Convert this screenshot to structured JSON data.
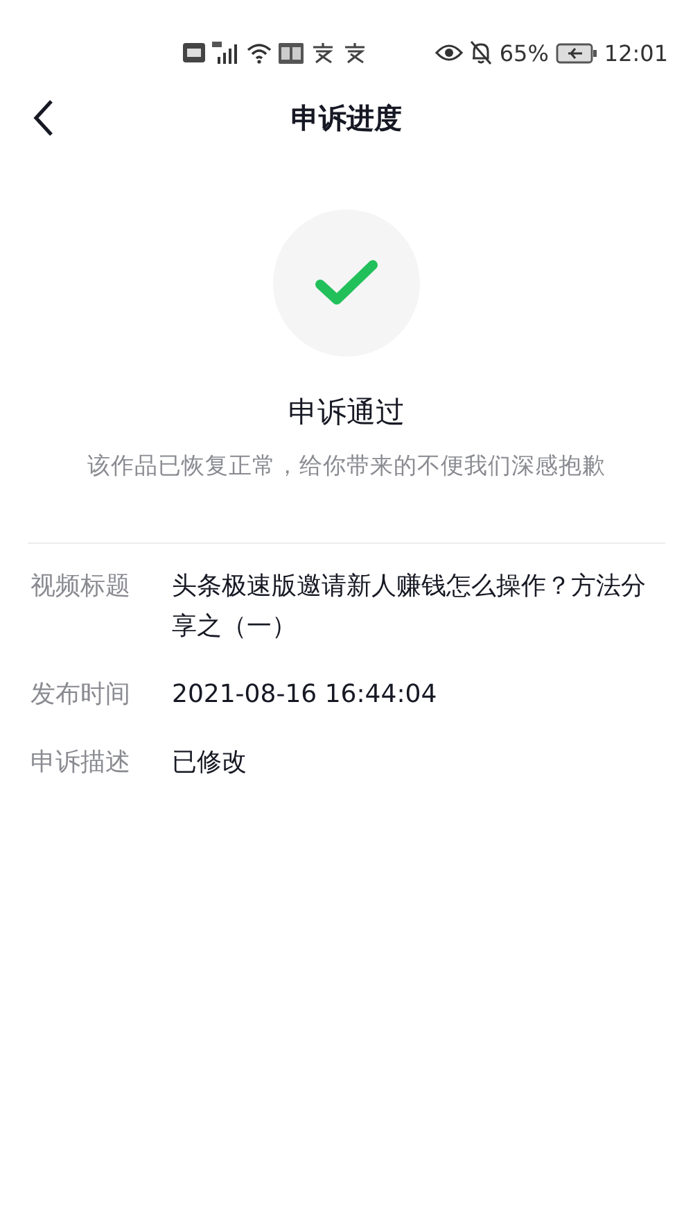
{
  "status_bar": {
    "battery": "65%",
    "time": "12:01"
  },
  "nav": {
    "title": "申诉进度"
  },
  "result": {
    "passed": true,
    "title": "申诉通过",
    "message": "该作品已恢复正常，给你带来的不便我们深感抱歉"
  },
  "details": [
    {
      "label": "视频标题",
      "value": "头条极速版邀请新人赚钱怎么操作？方法分享之（一）"
    },
    {
      "label": "发布时间",
      "value": "2021-08-16 16:44:04"
    },
    {
      "label": "申诉描述",
      "value": "已修改"
    }
  ]
}
